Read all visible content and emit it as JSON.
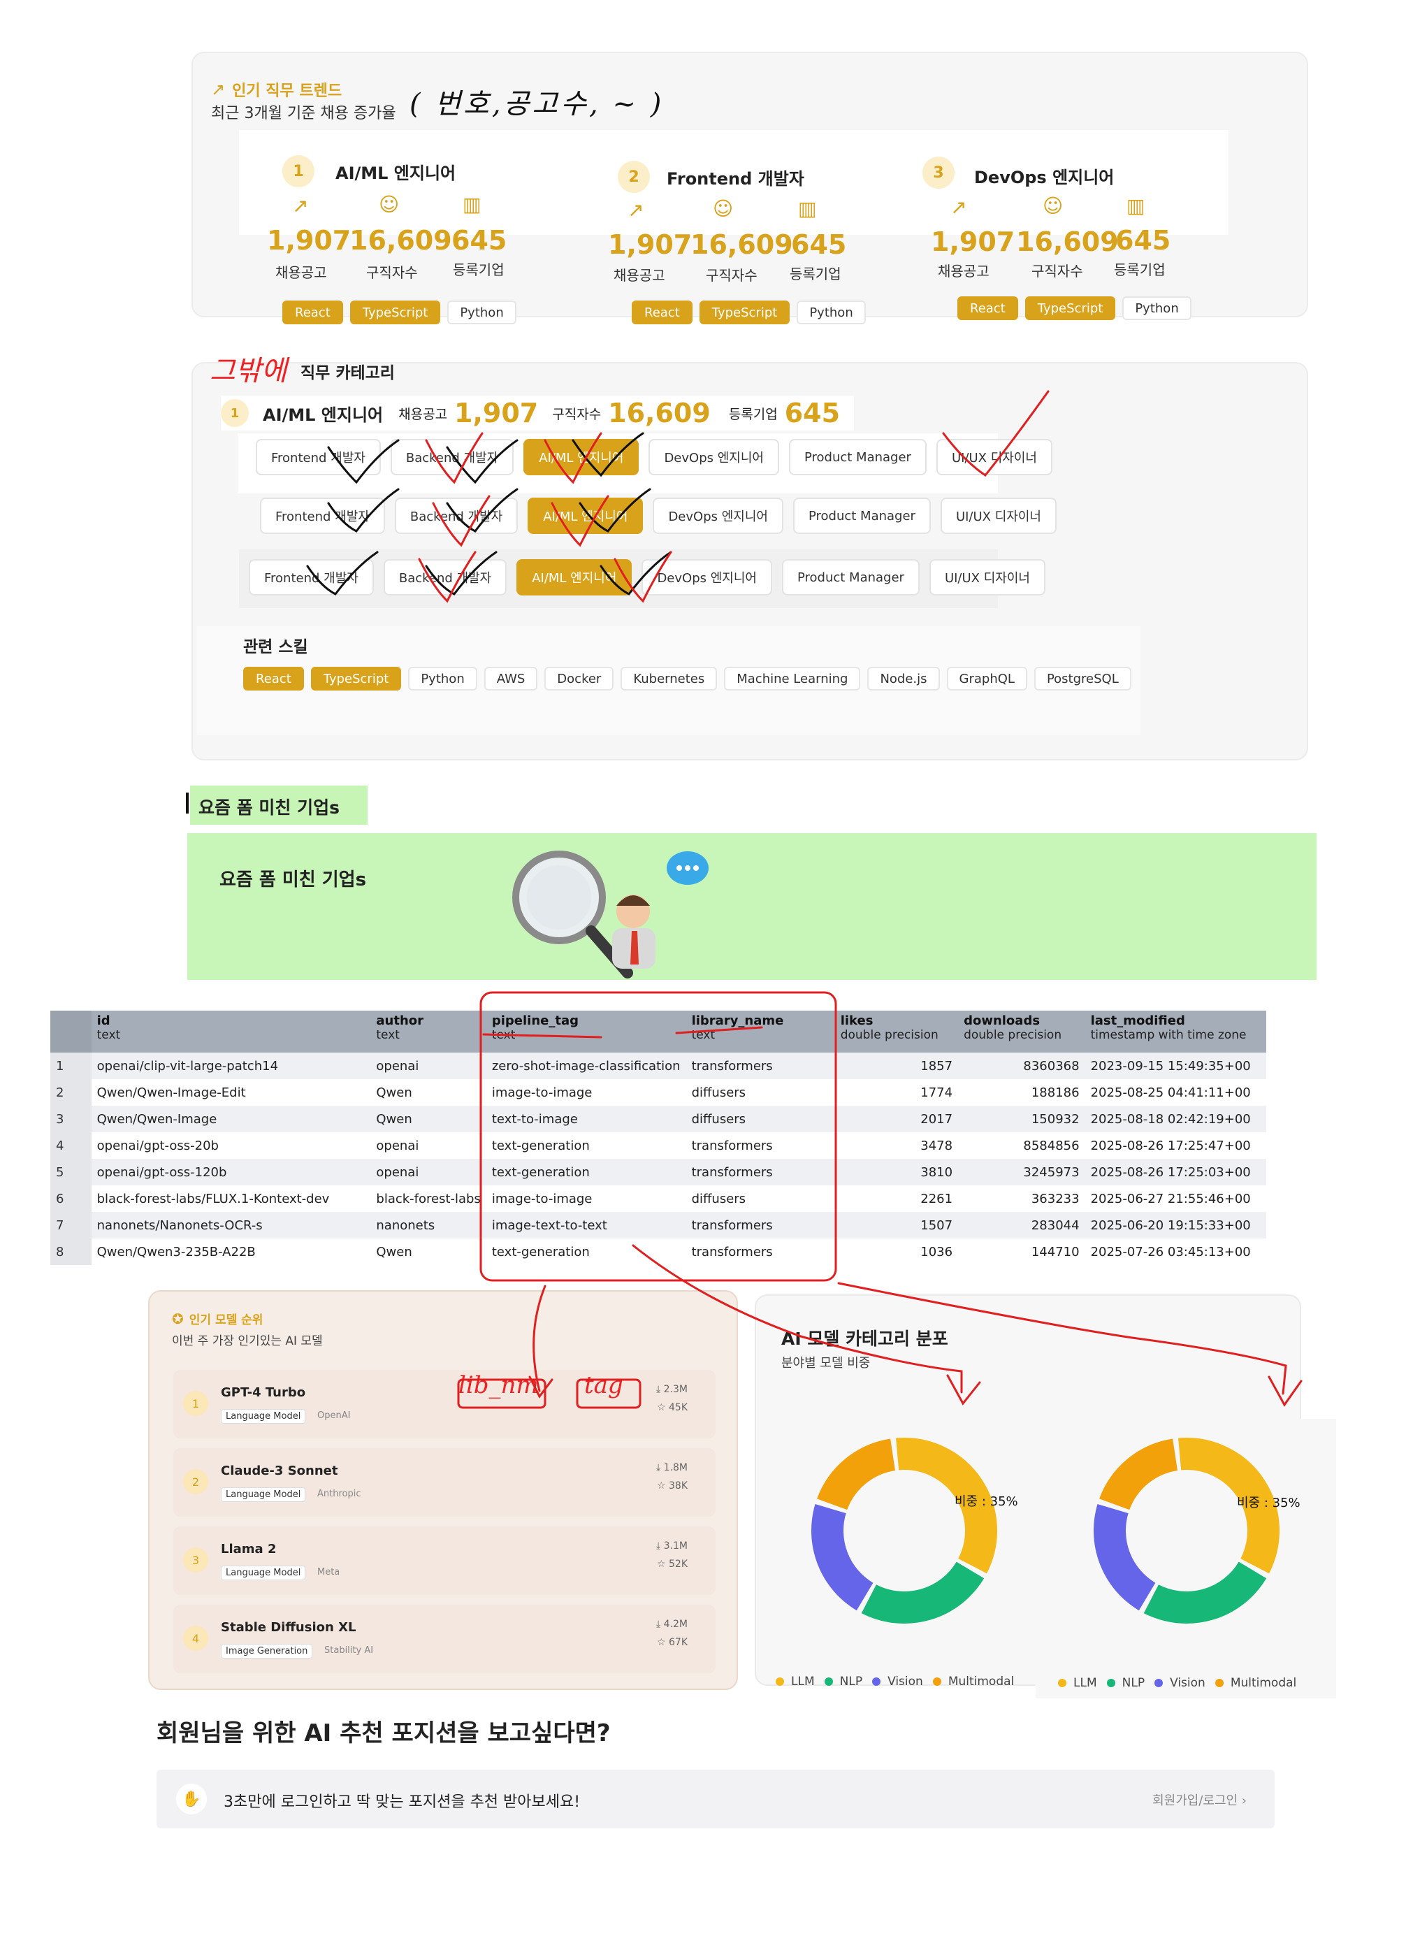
{
  "trend": {
    "title": "인기 직무 트렌드",
    "subtitle": "최근 3개월 기준 채용 증가율",
    "handwritten_note": "( 번호,공고수, ~ )",
    "cards": [
      {
        "rank": "1",
        "name": "AI/ML 엔지니어",
        "jobs": "1,907",
        "seekers": "16,609",
        "companies": "645",
        "jobs_label": "채용공고",
        "seekers_label": "구직자수",
        "companies_label": "등록기업",
        "tags": [
          "React",
          "TypeScript",
          "Python"
        ]
      },
      {
        "rank": "2",
        "name": "Frontend 개발자",
        "jobs": "1,907",
        "seekers": "16,609",
        "companies": "645",
        "jobs_label": "채용공고",
        "seekers_label": "구직자수",
        "companies_label": "등록기업",
        "tags": [
          "React",
          "TypeScript",
          "Python"
        ]
      },
      {
        "rank": "3",
        "name": "DevOps 엔지니어",
        "jobs": "1,907",
        "seekers": "16,609",
        "companies": "645",
        "jobs_label": "채용공고",
        "seekers_label": "구직자수",
        "companies_label": "등록기업",
        "tags": [
          "React",
          "TypeScript",
          "Python"
        ]
      }
    ]
  },
  "category": {
    "handwritten_note": "그밖에",
    "title": "직무 카테고리",
    "summary": {
      "rank": "1",
      "name": "AI/ML 엔지니어",
      "jobs_label": "채용공고",
      "jobs": "1,907",
      "seekers_label": "구직자수",
      "seekers": "16,609",
      "companies_label": "등록기업",
      "companies": "645"
    },
    "chips": [
      "Frontend 개발자",
      "Backend 개발자",
      "AI/ML 엔지니어",
      "DevOps 엔지니어",
      "Product Manager",
      "UI/UX 디자이너"
    ],
    "active_chip": "AI/ML 엔지니어",
    "skills_title": "관련 스킬",
    "skills": [
      "React",
      "TypeScript",
      "Python",
      "AWS",
      "Docker",
      "Kubernetes",
      "Machine Learning",
      "Node.js",
      "GraphQL",
      "PostgreSQL"
    ]
  },
  "hot": {
    "label": "요즘 폼 미친 기업s",
    "banner_title": "요즘 폼 미친 기업s"
  },
  "table": {
    "columns": [
      {
        "name": "id",
        "type": "text"
      },
      {
        "name": "author",
        "type": "text"
      },
      {
        "name": "pipeline_tag",
        "type": "text"
      },
      {
        "name": "library_name",
        "type": "text"
      },
      {
        "name": "likes",
        "type": "double precision"
      },
      {
        "name": "downloads",
        "type": "double precision"
      },
      {
        "name": "last_modified",
        "type": "timestamp with time zone"
      }
    ],
    "rows": [
      [
        "1",
        "openai/clip-vit-large-patch14",
        "openai",
        "zero-shot-image-classification",
        "transformers",
        "1857",
        "8360368",
        "2023-09-15 15:49:35+00"
      ],
      [
        "2",
        "Qwen/Qwen-Image-Edit",
        "Qwen",
        "image-to-image",
        "diffusers",
        "1774",
        "188186",
        "2025-08-25 04:41:11+00"
      ],
      [
        "3",
        "Qwen/Qwen-Image",
        "Qwen",
        "text-to-image",
        "diffusers",
        "2017",
        "150932",
        "2025-08-18 02:42:19+00"
      ],
      [
        "4",
        "openai/gpt-oss-20b",
        "openai",
        "text-generation",
        "transformers",
        "3478",
        "8584856",
        "2025-08-26 17:25:47+00"
      ],
      [
        "5",
        "openai/gpt-oss-120b",
        "openai",
        "text-generation",
        "transformers",
        "3810",
        "3245973",
        "2025-08-26 17:25:03+00"
      ],
      [
        "6",
        "black-forest-labs/FLUX.1-Kontext-dev",
        "black-forest-labs",
        "image-to-image",
        "diffusers",
        "2261",
        "363233",
        "2025-06-27 21:55:46+00"
      ],
      [
        "7",
        "nanonets/Nanonets-OCR-s",
        "nanonets",
        "image-text-to-text",
        "transformers",
        "1507",
        "283044",
        "2025-06-20 19:15:33+00"
      ],
      [
        "8",
        "Qwen/Qwen3-235B-A22B",
        "Qwen",
        "text-generation",
        "transformers",
        "1036",
        "144710",
        "2025-07-26 03:45:13+00"
      ]
    ]
  },
  "popular": {
    "title": "인기 모델 순위",
    "subtitle": "이번 주 가장 인기있는 AI 모델",
    "handwritten_note_1": "lib_nm",
    "handwritten_note_2": "tag",
    "models": [
      {
        "rank": "1",
        "name": "GPT-4 Turbo",
        "category": "Language Model",
        "org": "OpenAI",
        "downloads": "2.3M",
        "likes": "45K"
      },
      {
        "rank": "2",
        "name": "Claude-3 Sonnet",
        "category": "Language Model",
        "org": "Anthropic",
        "downloads": "1.8M",
        "likes": "38K"
      },
      {
        "rank": "3",
        "name": "Llama 2",
        "category": "Language Model",
        "org": "Meta",
        "downloads": "3.1M",
        "likes": "52K"
      },
      {
        "rank": "4",
        "name": "Stable Diffusion XL",
        "category": "Image Generation",
        "org": "Stability AI",
        "downloads": "4.2M",
        "likes": "67K"
      }
    ]
  },
  "distribution": {
    "title": "AI 모델 카테고리 분포",
    "subtitle": "분야별 모델 비중",
    "donut_label": "비중 : 35%",
    "legend": [
      "LLM",
      "NLP",
      "Vision",
      "Multimodal"
    ],
    "colors": {
      "LLM": "#f4b818",
      "NLP": "#17b877",
      "Vision": "#6465e8",
      "Multimodal": "#f2a10a"
    }
  },
  "chart_data": [
    {
      "type": "pie",
      "categories": [
        "LLM",
        "NLP",
        "Vision",
        "Multimodal"
      ],
      "values": [
        35,
        25,
        22,
        18
      ],
      "title": "",
      "annotation": "비중 : 35%"
    },
    {
      "type": "pie",
      "categories": [
        "LLM",
        "NLP",
        "Vision",
        "Multimodal"
      ],
      "values": [
        35,
        25,
        22,
        18
      ],
      "title": "",
      "annotation": "비중 : 35%"
    }
  ],
  "cta": {
    "heading": "회원님을 위한 AI 추천 포지션을 보고싶다면?",
    "message": "3초만에 로그인하고 딱 맞는 포지션을 추천 받아보세요!",
    "link": "회원가입/로그인",
    "link_arrow": "›",
    "hand_icon": "✋"
  }
}
